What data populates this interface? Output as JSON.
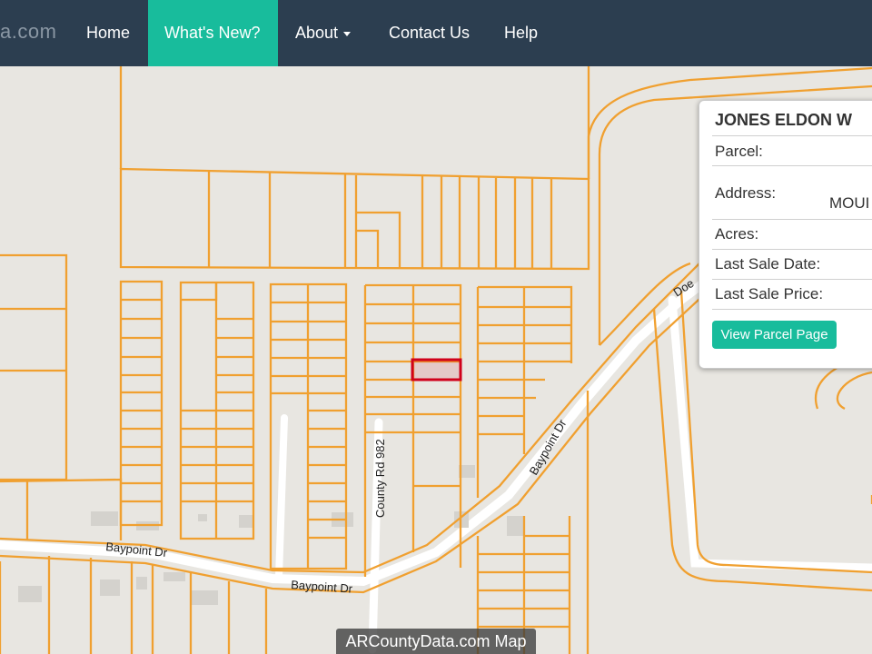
{
  "navbar": {
    "brand": "a.com",
    "items": [
      {
        "label": "Home"
      },
      {
        "label": "What's New?"
      },
      {
        "label": "About"
      },
      {
        "label": "Contact Us"
      },
      {
        "label": "Help"
      }
    ]
  },
  "map": {
    "street_labels": [
      "Doe",
      "Baypoint Dr",
      "Baypoint Dr",
      "Baypoint Dr",
      "County Rd 982"
    ],
    "attribution": "ARCountyData.com Map",
    "colors": {
      "background": "#e8e6e1",
      "parcel_line": "#f0a030",
      "road": "#ffffff",
      "selected_parcel": "#d0021b",
      "navbar": "#2c3e50",
      "accent": "#18bc9c"
    }
  },
  "popup": {
    "owner": "JONES ELDON W",
    "labels": {
      "parcel": "Parcel:",
      "address": "Address:",
      "acres": "Acres:",
      "last_sale_date": "Last Sale Date:",
      "last_sale_price": "Last Sale Price:"
    },
    "address_fragment": "MOUI",
    "button_label": "View Parcel Page"
  }
}
